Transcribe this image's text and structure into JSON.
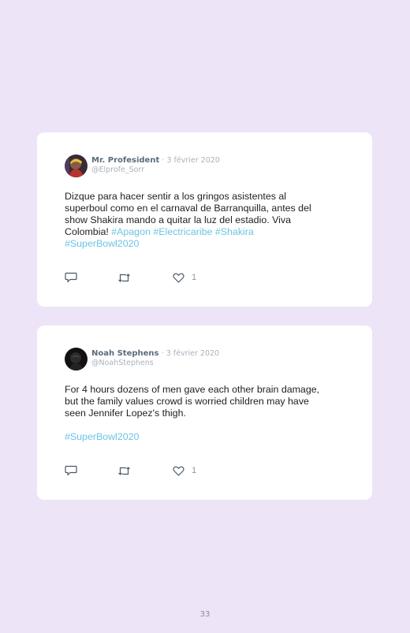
{
  "tweets": [
    {
      "name": "Mr. Profesident",
      "date": "· 3 février 2020",
      "handle": "@Elprofe_Sorr",
      "text_lines": [
        "Dizque para hacer sentir a los gringos asistentes al",
        "superboul como en el carnaval de Barranquilla, antes del",
        "show Shakira mando a quitar la luz del estadio. Viva"
      ],
      "text_tail": "Colombia! ",
      "hashtags_inline": [
        "#Apagon",
        "#Electricaribe",
        "#Shakira"
      ],
      "hashtag_last": "#SuperBowl2020",
      "like_count": "1",
      "avatar_icon": "profile-photo"
    },
    {
      "name": "Noah Stephens",
      "date": "· 3 février 2020",
      "handle": "@NoahStephens",
      "text_lines": [
        "For 4 hours dozens of men gave each other brain damage,",
        "but the family values crowd is worried children may have",
        "seen Jennifer Lopez's thigh."
      ],
      "hashtag_last": "#SuperBowl2020",
      "like_count": "1",
      "avatar_icon": "profile-photo"
    }
  ],
  "page_number": "33",
  "colors": {
    "background": "#ede4f7",
    "card": "#ffffff",
    "hashtag": "#6cc3e6",
    "name": "#5a6b7c",
    "meta": "#a9b2bb"
  }
}
